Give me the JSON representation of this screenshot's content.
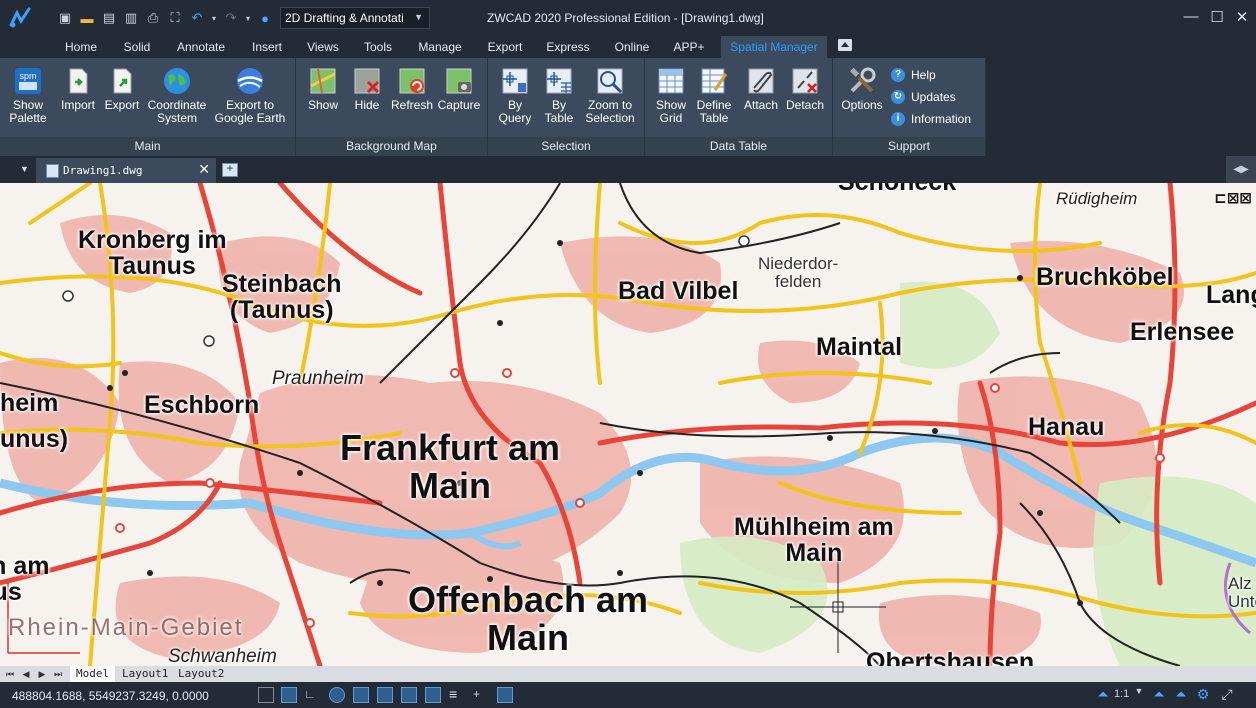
{
  "titlebar": {
    "workspace": "2D Drafting & Annotati",
    "window_title": "ZWCAD 2020 Professional Edition - [Drawing1.dwg]",
    "quick_access": [
      "new-icon",
      "open-icon",
      "save-icon",
      "save-as-icon",
      "print-icon",
      "select-all-icon",
      "undo-icon",
      "redo-icon",
      "help-icon"
    ]
  },
  "ribbon_tabs": [
    "Home",
    "Solid",
    "Annotate",
    "Insert",
    "Views",
    "Tools",
    "Manage",
    "Export",
    "Express",
    "Online",
    "APP+",
    "Spatial Manager"
  ],
  "active_tab": "Spatial Manager",
  "ribbon": {
    "groups": [
      {
        "label": "Main",
        "buttons": [
          {
            "label": "Show\nPalette",
            "icon": "spm-palette-icon"
          },
          {
            "label": "Import",
            "icon": "import-icon"
          },
          {
            "label": "Export",
            "icon": "export-icon"
          },
          {
            "label": "Coordinate\nSystem",
            "icon": "globe-icon"
          },
          {
            "label": "Export to\nGoogle Earth",
            "icon": "google-earth-icon"
          }
        ]
      },
      {
        "label": "Background Map",
        "buttons": [
          {
            "label": "Show",
            "icon": "map-show-icon"
          },
          {
            "label": "Hide",
            "icon": "map-hide-icon"
          },
          {
            "label": "Refresh",
            "icon": "map-refresh-icon"
          },
          {
            "label": "Capture",
            "icon": "map-capture-icon"
          }
        ]
      },
      {
        "label": "Selection",
        "buttons": [
          {
            "label": "By\nQuery",
            "icon": "select-query-icon"
          },
          {
            "label": "By\nTable",
            "icon": "select-table-icon"
          },
          {
            "label": "Zoom to\nSelection",
            "icon": "zoom-selection-icon"
          }
        ]
      },
      {
        "label": "Data Table",
        "buttons": [
          {
            "label": "Show\nGrid",
            "icon": "grid-icon"
          },
          {
            "label": "Define\nTable",
            "icon": "define-table-icon"
          },
          {
            "label": "Attach",
            "icon": "attach-icon"
          },
          {
            "label": "Detach",
            "icon": "detach-icon"
          }
        ]
      },
      {
        "label": "Support",
        "buttons": [
          {
            "label": "Options",
            "icon": "options-icon"
          }
        ],
        "small_buttons": [
          "Help",
          "Updates",
          "Information"
        ]
      }
    ]
  },
  "doc_tab": {
    "label": "Drawing1.dwg"
  },
  "map": {
    "places": [
      {
        "name": "Kronberg im\nTaunus",
        "size": "mid"
      },
      {
        "name": "Steinbach\n(Taunus)",
        "size": "mid"
      },
      {
        "name": "Bad Vilbel",
        "size": "mid"
      },
      {
        "name": "Niederdor-\nfelden",
        "size": "sm"
      },
      {
        "name": "Rüdigheim",
        "size": "it"
      },
      {
        "name": "Bruchköbel",
        "size": "mid"
      },
      {
        "name": "Lang",
        "size": "mid"
      },
      {
        "name": "Erlensee",
        "size": "mid"
      },
      {
        "name": "Maintal",
        "size": "mid"
      },
      {
        "name": "Praunheim",
        "size": "it"
      },
      {
        "name": "heim",
        "size": "mid"
      },
      {
        "name": "Eschborn",
        "size": "mid"
      },
      {
        "name": "unus)",
        "size": "mid"
      },
      {
        "name": "Frankfurt am\nMain",
        "size": "big"
      },
      {
        "name": "Hanau",
        "size": "mid"
      },
      {
        "name": "Mühlheim am\nMain",
        "size": "mid"
      },
      {
        "name": "Offenbach am\nMain",
        "size": "big"
      },
      {
        "name": "hen am\nunus",
        "size": "mid"
      },
      {
        "name": "Rhein-Main-Gebiet",
        "size": "region"
      },
      {
        "name": "Schwanheim",
        "size": "it"
      },
      {
        "name": "Obertshausen",
        "size": "mid"
      },
      {
        "name": "Schöneck",
        "size": "mid"
      },
      {
        "name": "Alz\nUnte",
        "size": "sm"
      }
    ]
  },
  "layout_tabs": [
    "Model",
    "Layout1",
    "Layout2"
  ],
  "active_layout": "Model",
  "status": {
    "coordinates": "488804.1688, 5549237.3249, 0.0000",
    "scale": "1:1"
  },
  "colors": {
    "accent": "#2f9bff",
    "ribbon_bg": "#3b4a5c",
    "titlebar_bg": "#232b36"
  }
}
